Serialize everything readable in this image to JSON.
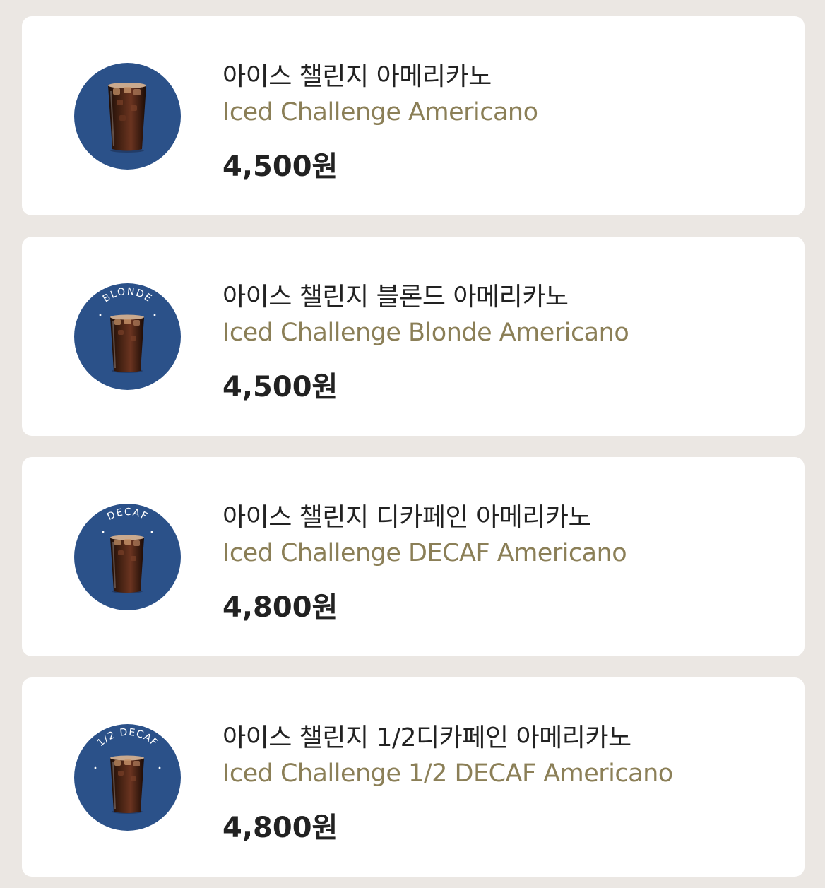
{
  "menu_items": [
    {
      "name_ko": "아이스 챌린지 아메리카노",
      "name_en": "Iced Challenge Americano",
      "price": "4,500원",
      "badge": "",
      "thumb_icon": "iced-americano-cup-icon"
    },
    {
      "name_ko": "아이스 챌린지 블론드 아메리카노",
      "name_en": "Iced Challenge Blonde Americano",
      "price": "4,500원",
      "badge": "BLONDE",
      "thumb_icon": "iced-americano-cup-icon"
    },
    {
      "name_ko": "아이스 챌린지 디카페인 아메리카노",
      "name_en": "Iced Challenge DECAF Americano",
      "price": "4,800원",
      "badge": "DECAF",
      "thumb_icon": "iced-americano-cup-icon"
    },
    {
      "name_ko": "아이스 챌린지 1/2디카페인 아메리카노",
      "name_en": "Iced Challenge 1/2 DECAF Americano",
      "price": "4,800원",
      "badge": "1/2 DECAF",
      "thumb_icon": "iced-americano-cup-icon"
    }
  ],
  "colors": {
    "background": "#ebe7e3",
    "card": "#ffffff",
    "thumb_circle": "#2b5189",
    "english_name": "#8b7f57",
    "text": "#222222"
  }
}
